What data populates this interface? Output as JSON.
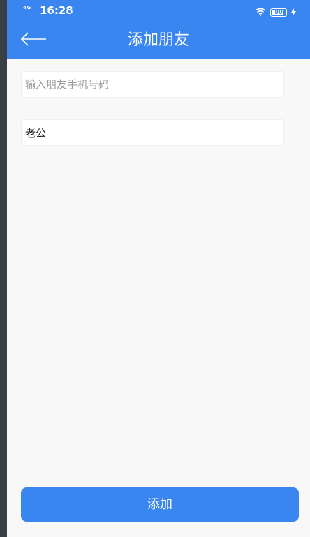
{
  "status_bar": {
    "network": "4G",
    "time": "16:28",
    "battery": "90"
  },
  "header": {
    "title": "添加朋友"
  },
  "form": {
    "phone_placeholder": "输入朋友手机号码",
    "phone_value": "",
    "name_value": "老公"
  },
  "actions": {
    "add_label": "添加"
  },
  "colors": {
    "accent": "#3a86f0",
    "background": "#f8f8f8"
  }
}
